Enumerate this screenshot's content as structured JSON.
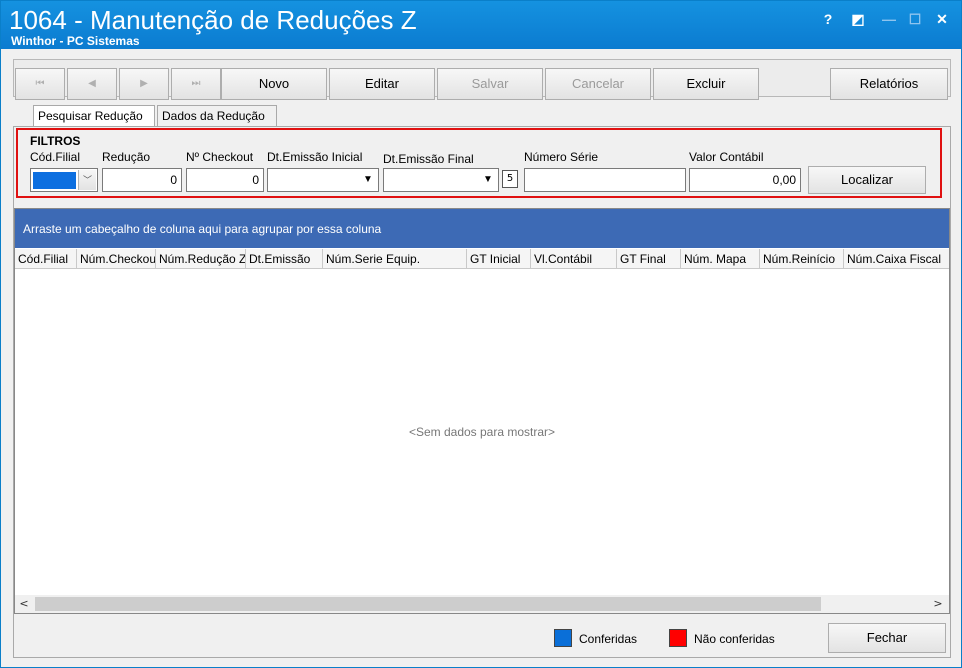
{
  "window": {
    "title": "1064 - Manutenção de Reduções Z",
    "subtitle": "Winthor - PC Sistemas",
    "help_glyph": "?",
    "restore_glyph": "◩",
    "minimize_glyph": "—",
    "close_glyph": "✕"
  },
  "toolbar": {
    "first_glyph": "⏮",
    "prev_glyph": "◀",
    "next_glyph": "▶",
    "last_glyph": "⏭",
    "novo": "Novo",
    "editar": "Editar",
    "salvar": "Salvar",
    "cancelar": "Cancelar",
    "excluir": "Excluir",
    "relatorios": "Relatórios"
  },
  "tabs": {
    "pesquisar": "Pesquisar Redução",
    "dados": "Dados da Redução"
  },
  "filters": {
    "title": "FILTROS",
    "cod_filial_label": "Cód.Filial",
    "reducao_label": "Redução",
    "reducao_value": "0",
    "checkout_label": "Nº Checkout",
    "checkout_value": "0",
    "dt_inicial_label": "Dt.Emissão Inicial",
    "dt_final_label": "Dt.Emissão Final",
    "numero_serie_label": "Número Série",
    "valor_contabil_label": "Valor Contábil",
    "valor_contabil_value": "0,00",
    "localizar": "Localizar"
  },
  "grid": {
    "group_hint": "Arraste um cabeçalho de coluna aqui para agrupar por essa coluna",
    "columns": [
      "Cód.Filial",
      "Núm.Checkout",
      "Núm.Redução Z",
      "Dt.Emissão",
      "Núm.Serie Equip.",
      "GT Inicial",
      "Vl.Contábil",
      "GT Final",
      "Núm. Mapa",
      "Núm.Reinício",
      "Núm.Caixa Fiscal"
    ],
    "empty_text": "<Sem dados para mostrar>"
  },
  "legend": {
    "conferidas": "Conferidas",
    "conferidas_color": "#0a6fd8",
    "nao_conferidas": "Não conferidas",
    "nao_conferidas_color": "#ff0000"
  },
  "footer": {
    "fechar": "Fechar"
  }
}
